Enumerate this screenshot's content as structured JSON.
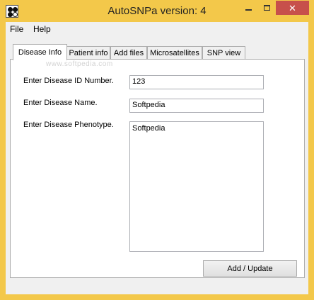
{
  "window": {
    "title": "AutoSNPa version: 4"
  },
  "menu": {
    "items": [
      "File",
      "Help"
    ]
  },
  "tabs": [
    "Disease Info",
    "Patient info",
    "Add files",
    "Microsatellites",
    "SNP view"
  ],
  "watermark": "www.softpedia.com",
  "form": {
    "id_label": "Enter Disease ID Number.",
    "id_value": "123",
    "name_label": "Enter Disease Name.",
    "name_value": "Softpedia",
    "phenotype_label": "Enter Disease Phenotype.",
    "phenotype_value": "Softpedia",
    "submit_label": "Add / Update"
  },
  "colors": {
    "titlebar": "#f3c84a",
    "close_button": "#c7504b"
  }
}
